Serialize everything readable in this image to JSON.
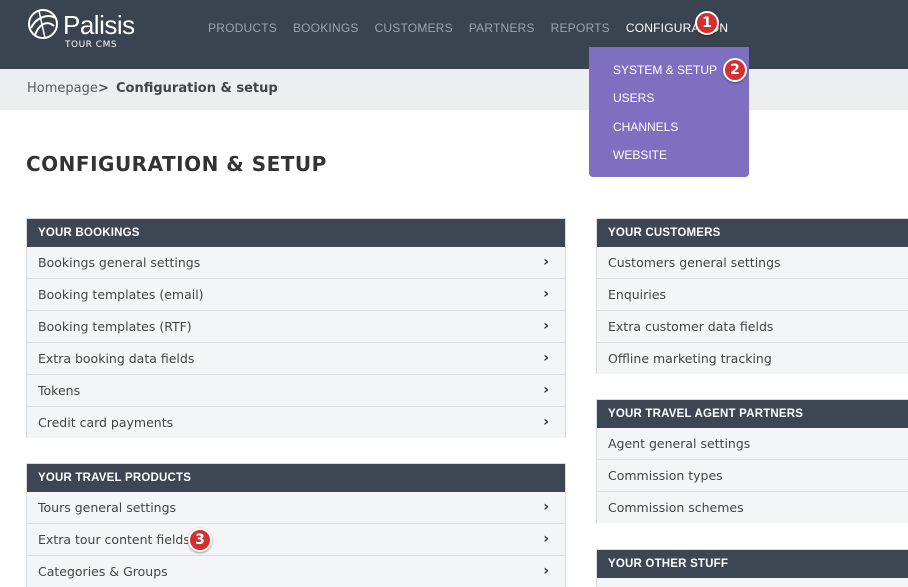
{
  "app": {
    "brand_name": "Palisis",
    "brand_sub": "TOUR CMS"
  },
  "nav": {
    "items": [
      {
        "label": "PRODUCTS"
      },
      {
        "label": "BOOKINGS"
      },
      {
        "label": "CUSTOMERS"
      },
      {
        "label": "PARTNERS"
      },
      {
        "label": "REPORTS"
      },
      {
        "label": "CONFIGURATION"
      }
    ],
    "active": "CONFIGURATION"
  },
  "dropdown": {
    "items": [
      {
        "label": "SYSTEM & SETUP"
      },
      {
        "label": "USERS"
      },
      {
        "label": "CHANNELS"
      },
      {
        "label": "WEBSITE"
      }
    ]
  },
  "breadcrumb": {
    "home": "Homepage",
    "separator": ">",
    "current": "Configuration & setup"
  },
  "page": {
    "title": "CONFIGURATION & SETUP"
  },
  "badges": [
    "1",
    "2",
    "3"
  ],
  "panels": {
    "bookings": {
      "title": "YOUR BOOKINGS",
      "rows": [
        "Bookings general settings",
        "Booking templates (email)",
        "Booking templates (RTF)",
        "Extra booking data fields",
        "Tokens",
        "Credit card payments"
      ]
    },
    "products": {
      "title": "YOUR TRAVEL PRODUCTS",
      "rows": [
        "Tours general settings",
        "Extra tour content fields",
        "Categories & Groups"
      ]
    },
    "customers": {
      "title": "YOUR CUSTOMERS",
      "rows": [
        "Customers general settings",
        "Enquiries",
        "Extra customer data fields",
        "Offline marketing tracking"
      ]
    },
    "agents": {
      "title": "YOUR TRAVEL AGENT PARTNERS",
      "rows": [
        "Agent general settings",
        "Commission types",
        "Commission schemes"
      ]
    },
    "other": {
      "title": "YOUR OTHER STUFF"
    }
  },
  "colors": {
    "header_bg": "#3a4350",
    "dropdown_bg": "#7e6fc1",
    "badge": "#d62f2f",
    "panel_head": "#3d4653"
  },
  "icons": {
    "chevron": "chevron-right-icon"
  }
}
